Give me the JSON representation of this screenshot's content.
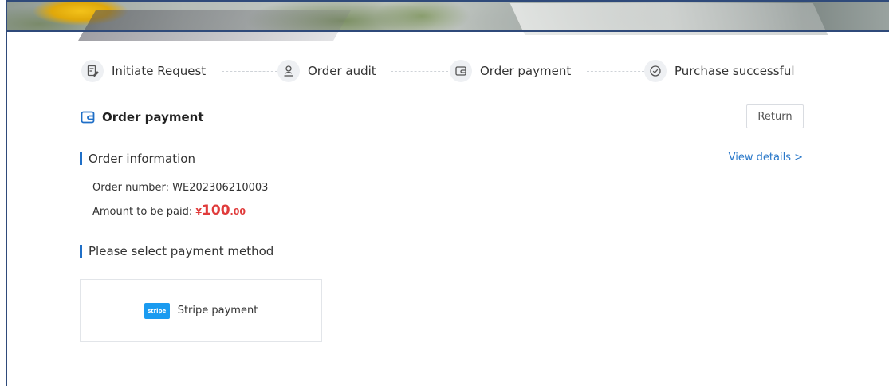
{
  "steps": [
    {
      "label": "Initiate Request",
      "icon": "edit-document-icon"
    },
    {
      "label": "Order audit",
      "icon": "user-stamp-icon"
    },
    {
      "label": "Order payment",
      "icon": "wallet-icon"
    },
    {
      "label": "Purchase successful",
      "icon": "check-circle-icon"
    }
  ],
  "header": {
    "title": "Order payment",
    "return_label": "Return",
    "accent": "#1f6fc7"
  },
  "order_info": {
    "section_title": "Order information",
    "view_details": "View details >",
    "order_number_label": "Order number:",
    "order_number": "WE202306210003",
    "amount_label": "Amount to be paid:",
    "currency": "¥",
    "amount_int": "100",
    "amount_dec": ".00",
    "amount_color": "#e03b3b"
  },
  "payment": {
    "section_title": "Please select payment method",
    "methods": [
      {
        "logo_text": "stripe",
        "label": "Stripe payment",
        "logo_color": "#1a9bf0"
      }
    ]
  }
}
